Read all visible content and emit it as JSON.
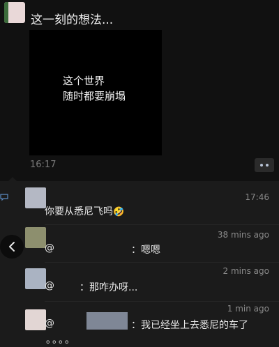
{
  "post": {
    "text": "这一刻的想法...",
    "image_lines": [
      "这个世界",
      "随时都要崩塌"
    ],
    "time": "16:17"
  },
  "comments": [
    {
      "time": "17:46",
      "text": "你要从悉尼飞吗",
      "emoji": "🤣",
      "avatar_color": "#b4b8c4"
    },
    {
      "time": "38 mins ago",
      "at": "@",
      "text": "：嗯嗯",
      "avatar_color": "#8d8f6e"
    },
    {
      "time": "2 mins ago",
      "at": "@",
      "text": "：那咋办呀...",
      "avatar_color": "#aab3c2"
    },
    {
      "time": "1 min ago",
      "at": "@",
      "text": "：我已经坐上去悉尼的车了",
      "continuation": "。。。。",
      "avatar_color": "#e2d6d4"
    }
  ]
}
